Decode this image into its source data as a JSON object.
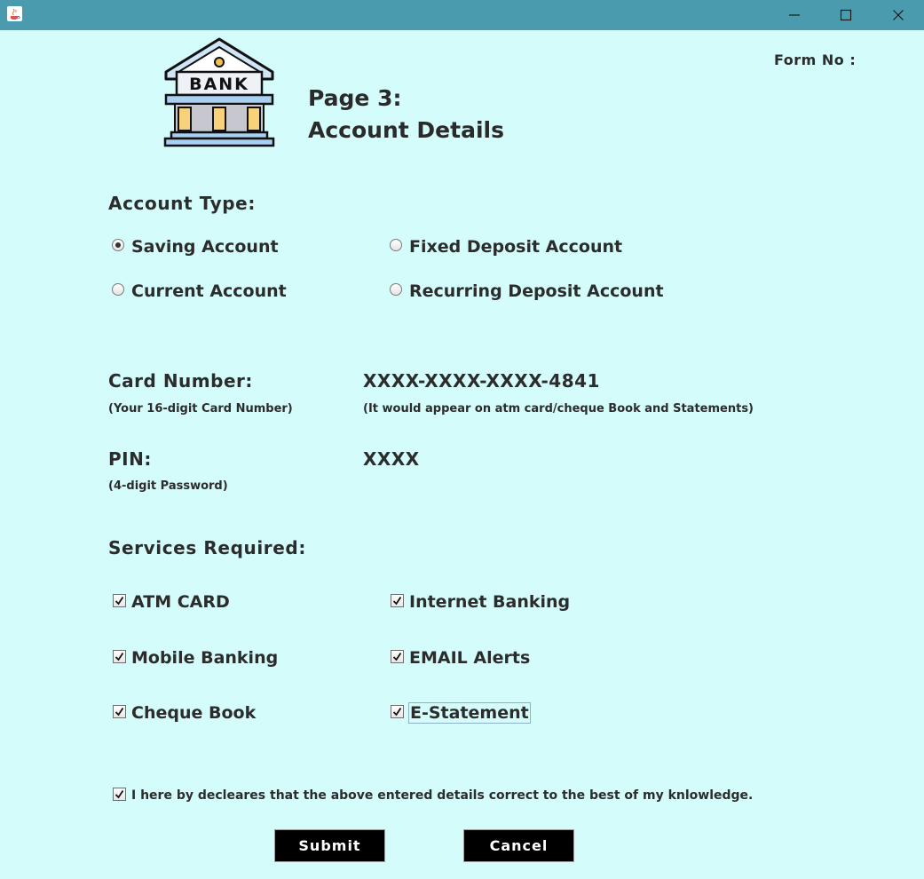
{
  "window": {
    "controls": [
      "minimize-icon",
      "maximize-icon",
      "close-icon"
    ]
  },
  "header": {
    "logo_text": "BANK",
    "page": "Page 3:",
    "title": "Account Details",
    "form_no_label": "Form No :"
  },
  "account_type": {
    "title": "Account Type:",
    "options": [
      {
        "label": "Saving Account",
        "selected": true
      },
      {
        "label": "Fixed Deposit Account",
        "selected": false
      },
      {
        "label": "Current Account",
        "selected": false
      },
      {
        "label": "Recurring Deposit Account",
        "selected": false
      }
    ]
  },
  "card": {
    "label": "Card Number:",
    "hint": "(Your 16-digit Card Number)",
    "value": "XXXX-XXXX-XXXX-4841",
    "note": "(It would appear on atm card/cheque Book and Statements)"
  },
  "pin": {
    "label": "PIN:",
    "hint": "(4-digit Password)",
    "value": "XXXX"
  },
  "services": {
    "title": "Services Required:",
    "items": [
      {
        "label": "ATM CARD",
        "checked": true
      },
      {
        "label": "Internet Banking",
        "checked": true
      },
      {
        "label": "Mobile Banking",
        "checked": true
      },
      {
        "label": "EMAIL Alerts",
        "checked": true
      },
      {
        "label": "Cheque Book",
        "checked": true
      },
      {
        "label": "E-Statement",
        "checked": true
      }
    ]
  },
  "declaration": {
    "text": "I here by decleares that the above entered details correct to the best of my knlowledge.",
    "checked": true
  },
  "buttons": {
    "submit": "Submit",
    "cancel": "Cancel"
  },
  "colors": {
    "background": "#d4fcfb",
    "titlebar": "#4a9bad",
    "button": "#000000"
  }
}
